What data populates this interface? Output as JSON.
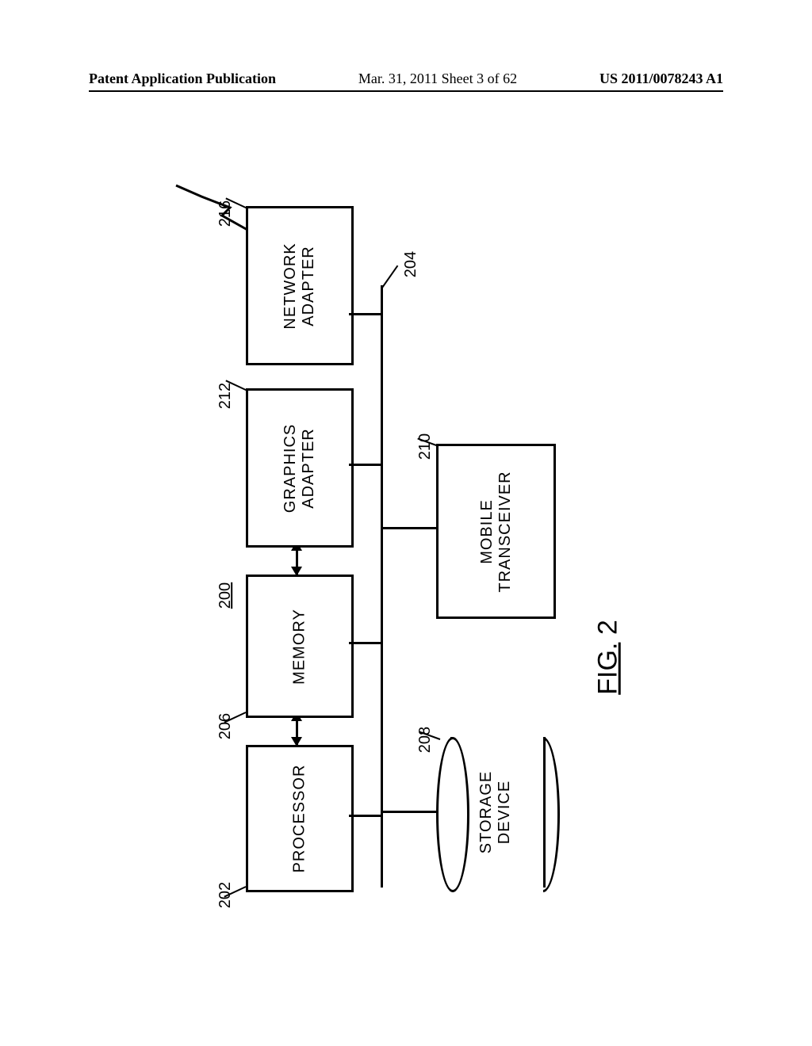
{
  "header": {
    "left": "Patent Application Publication",
    "center": "Mar. 31, 2011  Sheet 3 of 62",
    "right": "US 2011/0078243 A1"
  },
  "figure": {
    "caption_prefix": "FIG.",
    "caption_number": " 2",
    "system_ref": "200",
    "bus_ref": "204",
    "blocks": {
      "processor": {
        "label": "PROCESSOR",
        "ref": "202"
      },
      "memory": {
        "label": "MEMORY",
        "ref": "206"
      },
      "graphics_adapter": {
        "label": "GRAPHICS\nADAPTER",
        "ref": "212"
      },
      "network_adapter": {
        "label": "NETWORK\nADAPTER",
        "ref": "216"
      },
      "storage_device": {
        "label": "STORAGE\nDEVICE",
        "ref": "208"
      },
      "mobile_transceiver": {
        "label": "MOBILE\nTRANSCEIVER",
        "ref": "210"
      }
    }
  }
}
